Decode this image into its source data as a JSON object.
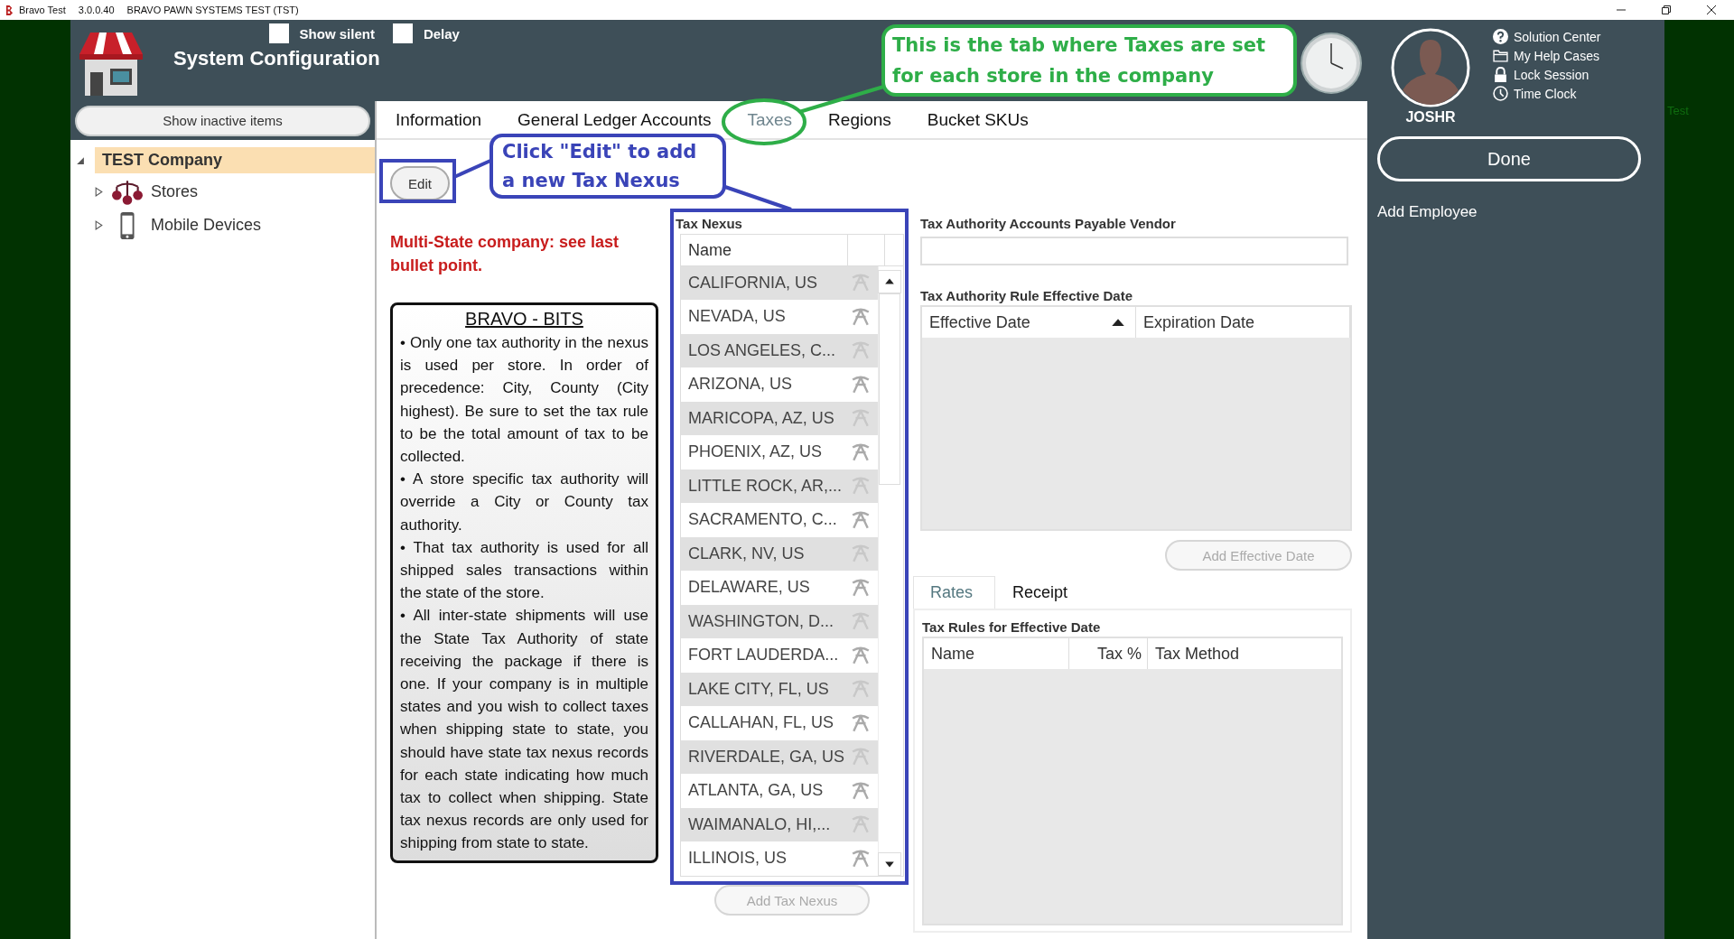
{
  "title_bar": {
    "app": "Bravo Test",
    "version": "3.0.0.40",
    "company": "BRAVO PAWN SYSTEMS TEST (TST)"
  },
  "header": {
    "title": "System Configuration",
    "options": [
      {
        "label": "Show silent",
        "checked": false
      },
      {
        "label": "Delay",
        "checked": false
      }
    ]
  },
  "user": {
    "name": "JOSHR",
    "links": [
      {
        "label": "Solution Center",
        "kind": "help"
      },
      {
        "label": "My Help Cases",
        "kind": "folder"
      },
      {
        "label": "Lock Session",
        "kind": "lock"
      },
      {
        "label": "Time Clock",
        "kind": "clock"
      }
    ],
    "done": "Done",
    "add_employee": "Add Employee",
    "env_tag": "Test"
  },
  "sidebar": {
    "toggle": "Show inactive items",
    "tree": [
      {
        "label": "TEST Company",
        "selected": true,
        "expanded": true,
        "children": [
          {
            "label": "Stores",
            "kind": "stores",
            "selected": false,
            "expanded": false
          },
          {
            "label": "Mobile Devices",
            "kind": "mobile",
            "selected": false,
            "expanded": false
          }
        ]
      }
    ]
  },
  "tabs": [
    {
      "label": "Information",
      "selected": false
    },
    {
      "label": "General Ledger Accounts",
      "selected": false
    },
    {
      "label": "Taxes",
      "selected": true
    },
    {
      "label": "Regions",
      "selected": false
    },
    {
      "label": "Bucket SKUs",
      "selected": false
    }
  ],
  "edit_button": {
    "label": "Edit",
    "disabled": false
  },
  "warning": "Multi-State company: see last bullet point.",
  "bits": {
    "title": "BRAVO - BITS",
    "points": [
      "• Only one tax authority in the nexus is used per store.  In order of precedence: City, County (City highest). Be sure to set the tax rule to be the total amount of tax to be collected.",
      "• A store specific tax authority will override a City or County tax authority.",
      "• That tax authority is used for all shipped sales transactions within the state of the store.",
      "• All inter-state shipments will use the State Tax Authority of state receiving the package if there is one.  If your company is in multiple states and you wish to collect taxes when shipping state to state, you should have state tax nexus records for each state indicating how much tax to collect when shipping.  State tax nexus records are only used for shipping from state to state."
    ]
  },
  "tax_nexus": {
    "label": "Tax Nexus",
    "column": "Name",
    "rows": [
      "CALIFORNIA, US",
      "NEVADA, US",
      "LOS ANGELES, C...",
      "ARIZONA, US",
      "MARICOPA, AZ, US",
      "PHOENIX, AZ, US",
      "LITTLE ROCK, AR,...",
      "SACRAMENTO, C...",
      "CLARK, NV, US",
      "DELAWARE, US",
      "WASHINGTON, D...",
      "FORT LAUDERDA...",
      "LAKE CITY, FL, US",
      "CALLAHAN, FL, US",
      "RIVERDALE, GA, US",
      "ATLANTA, GA, US",
      "WAIMANALO, HI,...",
      "ILLINOIS, US"
    ],
    "add_button": {
      "label": "Add Tax Nexus",
      "disabled": true
    }
  },
  "vendor": {
    "label": "Tax Authority Accounts Payable Vendor"
  },
  "effective_dates": {
    "label": "Tax Authority Rule Effective Date",
    "columns": [
      {
        "label": "Effective Date",
        "sorted": true
      },
      {
        "label": "Expiration Date",
        "sorted": false
      }
    ],
    "add_button": {
      "label": "Add Effective Date",
      "disabled": true
    }
  },
  "rule_tabs": [
    {
      "label": "Rates",
      "selected": true
    },
    {
      "label": "Receipt",
      "selected": false
    }
  ],
  "tax_rules": {
    "label": "Tax Rules for Effective Date",
    "columns": [
      {
        "label": "Name",
        "kind": "text"
      },
      {
        "label": "Tax %",
        "kind": "number"
      },
      {
        "label": "Tax Method",
        "kind": "text"
      }
    ]
  },
  "annotations": [
    {
      "text": "This is the tab where Taxes are set for each store in the company",
      "color": "#2eae48"
    },
    {
      "text": "Click \"Edit\" to add a new Tax Nexus",
      "color": "#3a44b8"
    }
  ]
}
